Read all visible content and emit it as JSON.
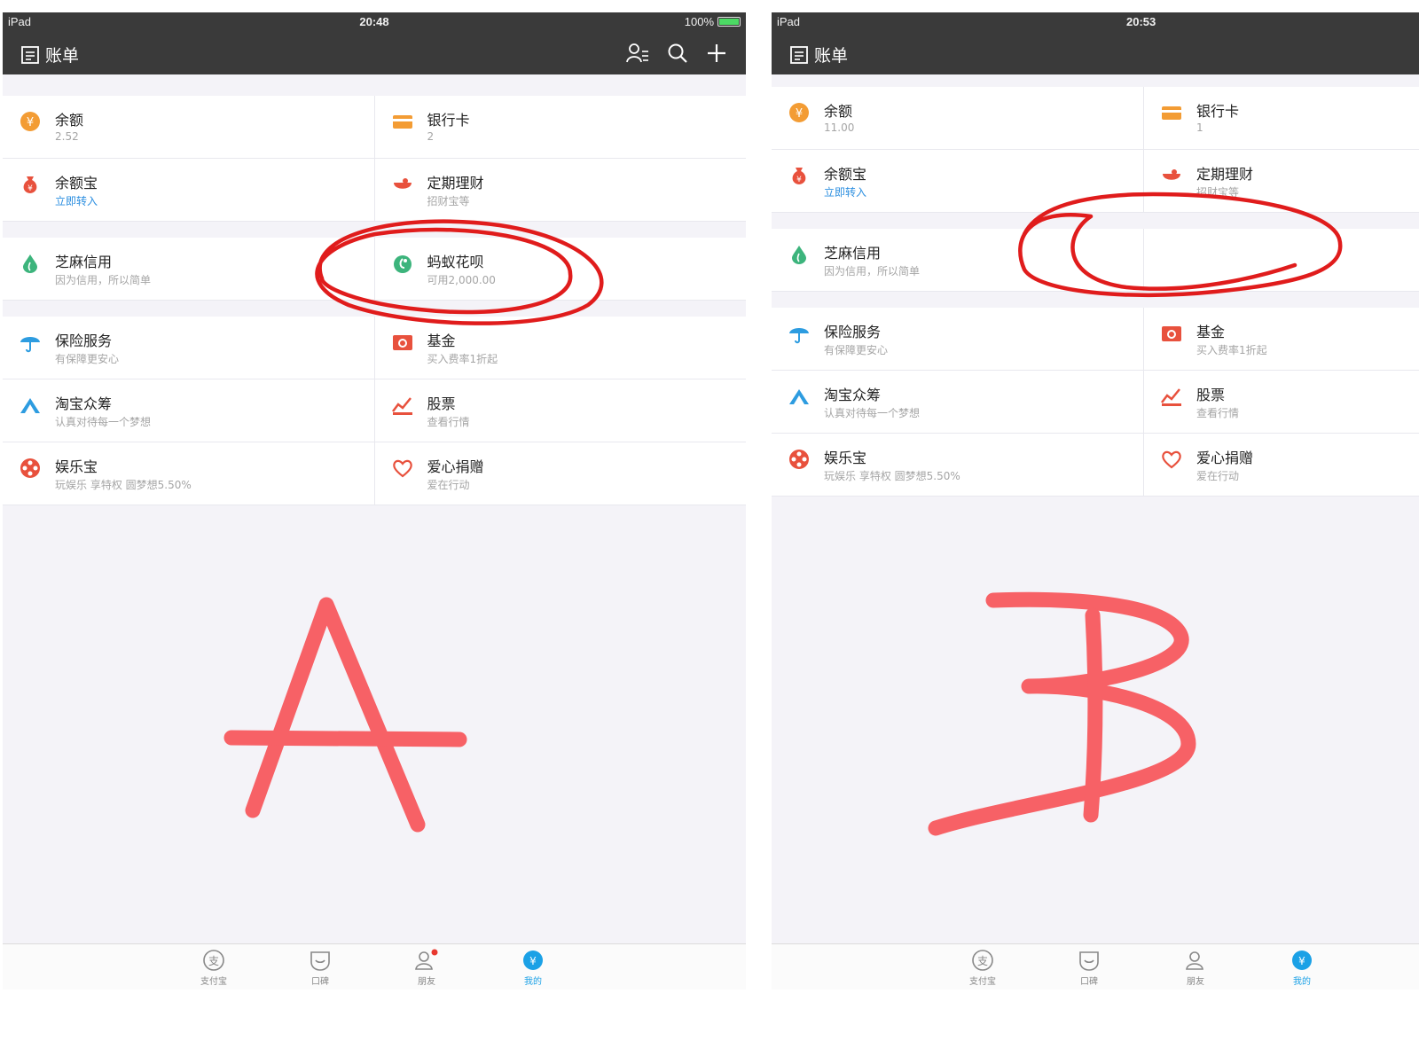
{
  "colors": {
    "accent": "#1ba1e6",
    "annotation_red": "#e01c1c",
    "annotation_pink": "#f76166",
    "navbar": "#3a3a3a"
  },
  "screens": [
    {
      "status": {
        "device": "iPad",
        "time": "20:48",
        "battery": "100%"
      },
      "nav_title": "账单",
      "cells": [
        {
          "title": "余额",
          "sub": "2.52",
          "icon": "yuan-coin-icon"
        },
        {
          "title": "银行卡",
          "sub": "2",
          "icon": "bank-card-icon"
        },
        {
          "title": "余额宝",
          "sub": "立即转入",
          "icon": "money-bag-icon"
        },
        {
          "title": "定期理财",
          "sub": "招财宝等",
          "icon": "bowl-icon"
        },
        {
          "title": "芝麻信用",
          "sub": "因为信用，所以简单",
          "icon": "sesame-drop-icon"
        },
        {
          "title": "蚂蚁花呗",
          "sub": "可用2,000.00",
          "icon": "huabei-icon"
        },
        {
          "title": "保险服务",
          "sub": "有保障更安心",
          "icon": "umbrella-icon"
        },
        {
          "title": "基金",
          "sub": "买入费率1折起",
          "icon": "fund-icon"
        },
        {
          "title": "淘宝众筹",
          "sub": "认真对待每一个梦想",
          "icon": "crowdfund-icon"
        },
        {
          "title": "股票",
          "sub": "查看行情",
          "icon": "stock-chart-icon"
        },
        {
          "title": "娱乐宝",
          "sub": "玩娱乐 享特权 圆梦想5.50%",
          "icon": "film-reel-icon"
        },
        {
          "title": "爱心捐赠",
          "sub": "爱在行动",
          "icon": "heart-icon"
        }
      ],
      "tabs": [
        "支付宝",
        "口碑",
        "朋友",
        "我的"
      ],
      "annotation_letter": "A"
    },
    {
      "status": {
        "device": "iPad",
        "time": "20:53"
      },
      "nav_title": "账单",
      "cells": [
        {
          "title": "余额",
          "sub": "11.00",
          "icon": "yuan-coin-icon"
        },
        {
          "title": "银行卡",
          "sub": "1",
          "icon": "bank-card-icon"
        },
        {
          "title": "余额宝",
          "sub": "立即转入",
          "icon": "money-bag-icon"
        },
        {
          "title": "定期理财",
          "sub": "招财宝等",
          "icon": "bowl-icon"
        },
        {
          "title": "芝麻信用",
          "sub": "因为信用，所以简单",
          "icon": "sesame-drop-icon"
        },
        {
          "title": "保险服务",
          "sub": "有保障更安心",
          "icon": "umbrella-icon"
        },
        {
          "title": "基金",
          "sub": "买入费率1折起",
          "icon": "fund-icon"
        },
        {
          "title": "淘宝众筹",
          "sub": "认真对待每一个梦想",
          "icon": "crowdfund-icon"
        },
        {
          "title": "股票",
          "sub": "查看行情",
          "icon": "stock-chart-icon"
        },
        {
          "title": "娱乐宝",
          "sub": "玩娱乐 享特权 圆梦想5.50%",
          "icon": "film-reel-icon"
        },
        {
          "title": "爱心捐赠",
          "sub": "爱在行动",
          "icon": "heart-icon"
        }
      ],
      "tabs": [
        "支付宝",
        "口碑",
        "朋友",
        "我的"
      ],
      "annotation_letter": "B"
    }
  ]
}
